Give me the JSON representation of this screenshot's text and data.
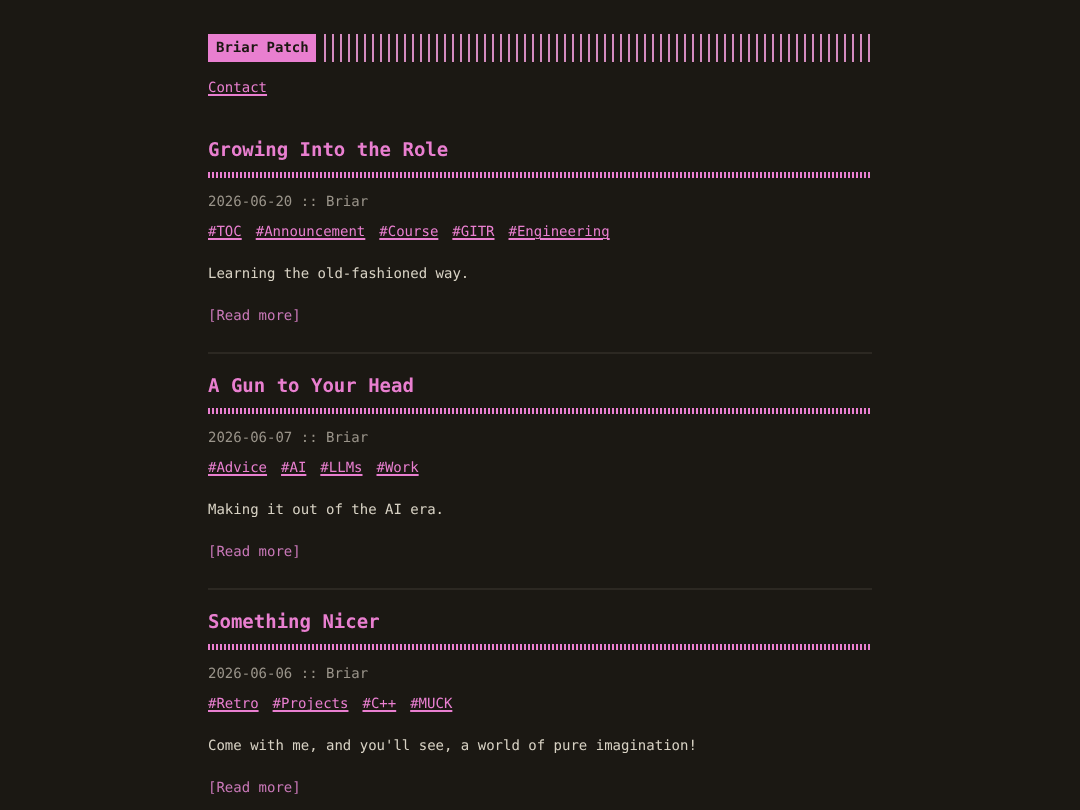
{
  "header": {
    "logo": "Briar Patch",
    "nav": [
      "Contact"
    ]
  },
  "posts": [
    {
      "title": "Growing Into the Role",
      "meta": "2026-06-20 :: Briar",
      "tags": [
        "#TOC",
        "#Announcement",
        "#Course",
        "#GITR",
        "#Engineering"
      ],
      "summary": "Learning the old-fashioned way.",
      "read_more": "[Read more]"
    },
    {
      "title": "A Gun to Your Head",
      "meta": "2026-06-07 :: Briar",
      "tags": [
        "#Advice",
        "#AI",
        "#LLMs",
        "#Work"
      ],
      "summary": "Making it out of the AI era.",
      "read_more": "[Read more]"
    },
    {
      "title": "Something Nicer",
      "meta": "2026-06-06 :: Briar",
      "tags": [
        "#Retro",
        "#Projects",
        "#C++",
        "#MUCK"
      ],
      "summary": "Come with me, and you'll see, a world of pure imagination!",
      "read_more": "[Read more]"
    }
  ]
}
